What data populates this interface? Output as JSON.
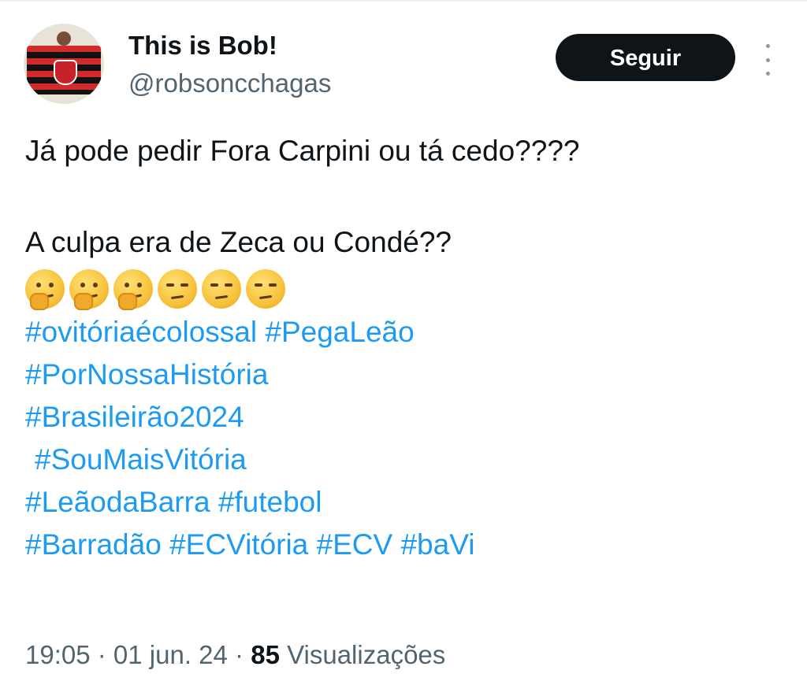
{
  "author": {
    "name": "This is Bob!",
    "handle": "@robsoncchagas",
    "avatar_icon": "avatar-flag-photo"
  },
  "actions": {
    "follow_label": "Seguir",
    "more_icon": "more-vertical-icon"
  },
  "tweet": {
    "line1": "Já pode pedir Fora Carpini ou tá cedo????",
    "line2": "A culpa era de Zeca ou Condé??",
    "emojis": [
      "thinking-face",
      "thinking-face",
      "thinking-face",
      "unamused-face",
      "unamused-face",
      "unamused-face"
    ],
    "hashtag_lines": [
      [
        "#ovitóriaécolossal",
        "#PegaLeão"
      ],
      [
        "#PorNossaHistória"
      ],
      [
        "#Brasileirão2024"
      ],
      [
        "#SouMaisVitória"
      ],
      [
        "#LeãodaBarra",
        "#futebol"
      ],
      [
        "#Barradão",
        "#ECVitória",
        "#ECV",
        "#baVi"
      ]
    ]
  },
  "meta": {
    "time": "19:05",
    "date": "01 jun. 24",
    "separator": " · ",
    "views_count": "85",
    "views_label": "Visualizações"
  },
  "colors": {
    "link": "#1d9bf0",
    "text": "#0f1419",
    "secondary": "#536471",
    "button_bg": "#0f1419"
  }
}
